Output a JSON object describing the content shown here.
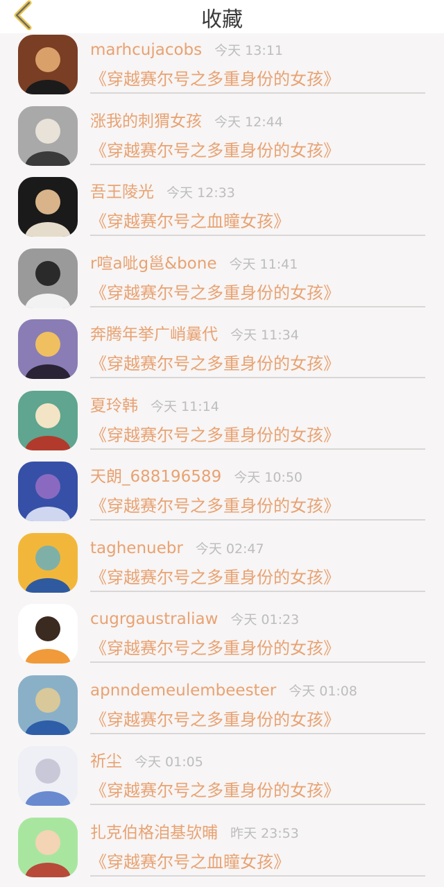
{
  "header": {
    "title": "收藏",
    "back_icon": "chevron-left-icon",
    "accent_color": "#e8c44a"
  },
  "colors": {
    "accent": "#e8a272",
    "muted": "#bdbdbd",
    "background": "#f7f5f5"
  },
  "items": [
    {
      "username": "marhcujacobs",
      "time": "今天 13:11",
      "book": "《穿越赛尔号之多重身份的女孩》",
      "avatar": "woman-portrait-avatar",
      "palette": [
        "#7a3e24",
        "#1b1b1b",
        "#d9a06a"
      ]
    },
    {
      "username": "涨我的刺猬女孩",
      "time": "今天 12:44",
      "book": "《穿越赛尔号之多重身份的女孩》",
      "avatar": "bw-portrait-avatar",
      "palette": [
        "#a9a9a9",
        "#3a3a3a",
        "#e8e2d8"
      ]
    },
    {
      "username": "吾王陵光",
      "time": "今天 12:33",
      "book": "《穿越赛尔号之血瞳女孩》",
      "avatar": "hat-girl-avatar",
      "palette": [
        "#1a1a1a",
        "#e6dccb",
        "#d9b48a"
      ]
    },
    {
      "username": "r喧a呲g邕&bone",
      "time": "今天 11:41",
      "book": "《穿越赛尔号之多重身份的女孩》",
      "avatar": "man-with-bear-avatar",
      "palette": [
        "#9a9a9a",
        "#f2f2f2",
        "#2a2a2a"
      ]
    },
    {
      "username": "奔腾年挙广峭曩代",
      "time": "今天 11:34",
      "book": "《穿越赛尔号之多重身份的女孩》",
      "avatar": "long-hair-girl-avatar",
      "palette": [
        "#8a7db5",
        "#2a2336",
        "#f0c060"
      ]
    },
    {
      "username": "夏玲韩",
      "time": "今天 11:14",
      "book": "《穿越赛尔号之多重身份的女孩》",
      "avatar": "anime-red-outfit-avatar",
      "palette": [
        "#5fa58f",
        "#b23a2c",
        "#f3e4c6"
      ]
    },
    {
      "username": "天朗_688196589",
      "time": "今天 10:50",
      "book": "《穿越赛尔号之多重身份的女孩》",
      "avatar": "anime-blue-boy-avatar",
      "palette": [
        "#3650a8",
        "#cfd6f0",
        "#8a6ac0"
      ]
    },
    {
      "username": "taghenuebr",
      "time": "今天 02:47",
      "book": "《穿越赛尔号之多重身份的女孩》",
      "avatar": "umbrella-girl-avatar",
      "palette": [
        "#f2b73a",
        "#2f5aa0",
        "#7fb0a8"
      ]
    },
    {
      "username": "cugrgaustraliaw",
      "time": "今天 01:23",
      "book": "《穿越赛尔号之多重身份的女孩》",
      "avatar": "cartoon-tiger-avatar",
      "palette": [
        "#ffffff",
        "#f09a3a",
        "#3a2a20"
      ]
    },
    {
      "username": "apnndemeulembeester",
      "time": "今天 01:08",
      "book": "《穿越赛尔号之多重身份的女孩》",
      "avatar": "blue-star-avatar",
      "palette": [
        "#8ab0c8",
        "#2e5ea8",
        "#d8c89a"
      ]
    },
    {
      "username": "祈尘",
      "time": "今天 01:05",
      "book": "《穿越赛尔号之多重身份的女孩》",
      "avatar": "white-hair-anime-avatar",
      "palette": [
        "#eef0f6",
        "#6a8ad0",
        "#c8c8d8"
      ]
    },
    {
      "username": "扎克伯格洎基欤晡",
      "time": "昨天 23:53",
      "book": "《穿越赛尔号之血瞳女孩》",
      "avatar": "cartoon-kids-avatar",
      "palette": [
        "#a8e6a0",
        "#b84a3a",
        "#f3d4b4"
      ]
    }
  ]
}
